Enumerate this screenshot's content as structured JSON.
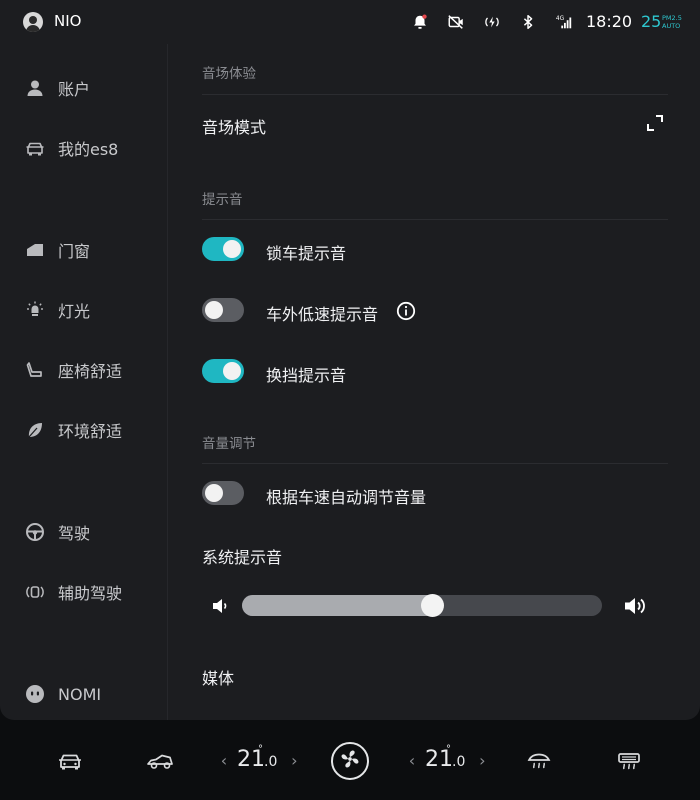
{
  "status_bar": {
    "brand": "NIO",
    "time": "18:20",
    "aqi_value": "25",
    "aqi_label_line1": "PM2.5",
    "aqi_label_line2": "AUTO",
    "network": "4G",
    "accent_color": "#2ec8d0",
    "icons": [
      "notification-bell-icon",
      "camera-off-icon",
      "wireless-charging-icon",
      "bluetooth-icon",
      "signal-4g-icon"
    ]
  },
  "sidebar": {
    "items": [
      {
        "label": "账户",
        "icon": "user-icon"
      },
      {
        "label": "我的es8",
        "icon": "car-icon"
      },
      {
        "label": "门窗",
        "icon": "window-icon"
      },
      {
        "label": "灯光",
        "icon": "light-icon"
      },
      {
        "label": "座椅舒适",
        "icon": "seat-icon"
      },
      {
        "label": "环境舒适",
        "icon": "leaf-icon"
      },
      {
        "label": "驾驶",
        "icon": "steering-wheel-icon"
      },
      {
        "label": "辅助驾驶",
        "icon": "driver-assist-icon"
      },
      {
        "label": "NOMI",
        "icon": "nomi-icon"
      }
    ]
  },
  "content": {
    "section_sound_field": "音场体验",
    "sound_field_mode": "音场模式",
    "section_alerts": "提示音",
    "toggles": [
      {
        "label": "锁车提示音",
        "on": true
      },
      {
        "label": "车外低速提示音",
        "on": false
      },
      {
        "label": "换挡提示音",
        "on": true
      }
    ],
    "section_volume": "音量调节",
    "speed_volume": {
      "label": "根据车速自动调节音量",
      "on": false
    },
    "system_alert_volume_label": "系统提示音",
    "system_alert_volume_fraction": 0.53,
    "media_label": "媒体"
  },
  "climate": {
    "left_temp_int": "21",
    "left_temp_dec": ".0",
    "right_temp_int": "21",
    "right_temp_dec": ".0",
    "degree_symbol": "°",
    "chevron_left": "‹",
    "chevron_right": "›",
    "icons": [
      "car-front-icon",
      "convertible-car-icon",
      "fan-icon",
      "front-defrost-icon",
      "rear-defrost-icon"
    ]
  }
}
